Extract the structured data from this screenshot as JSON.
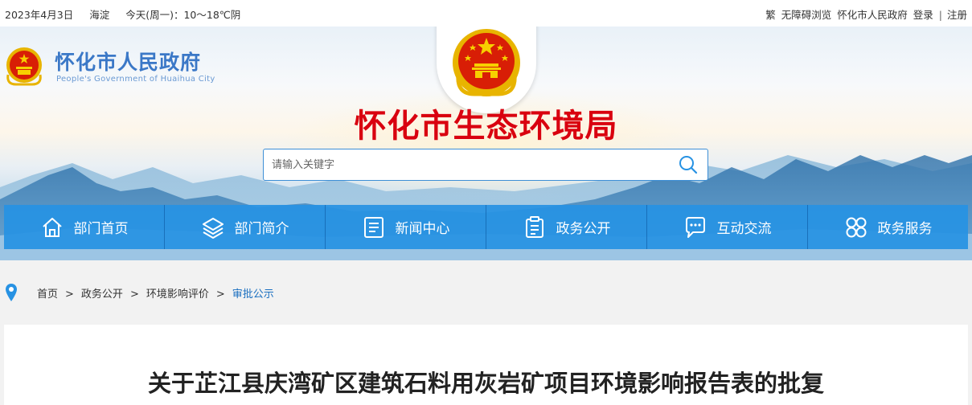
{
  "topbar": {
    "date": "2023年4月3日",
    "city": "海淀",
    "weather": "今天(周一)：10～18℃阴",
    "traditional": "繁",
    "accessibility": "无障碍浏览",
    "gov_link": "怀化市人民政府",
    "login": "登录",
    "separator": "|",
    "register": "注册"
  },
  "header": {
    "gov_name": "怀化市人民政府",
    "gov_name_en": "People's Government of Huaihua City",
    "site_title": "怀化市生态环境局"
  },
  "search": {
    "placeholder": "请输入关键字"
  },
  "nav": {
    "items": [
      {
        "label": "部门首页",
        "icon": "home-icon"
      },
      {
        "label": "部门简介",
        "icon": "layers-icon"
      },
      {
        "label": "新闻中心",
        "icon": "document-icon"
      },
      {
        "label": "政务公开",
        "icon": "clipboard-icon"
      },
      {
        "label": "互动交流",
        "icon": "chat-icon"
      },
      {
        "label": "政务服务",
        "icon": "grid-icon"
      }
    ]
  },
  "breadcrumb": {
    "items": [
      "首页",
      "政务公开",
      "环境影响评价",
      "审批公示"
    ],
    "arrow": ">"
  },
  "article": {
    "title": "关于芷江县庆湾矿区建筑石料用灰岩矿项目环境影响报告表的批复"
  },
  "colors": {
    "accent": "#2792e3",
    "title_red": "#d9000f",
    "link_blue": "#1a6fc0"
  }
}
